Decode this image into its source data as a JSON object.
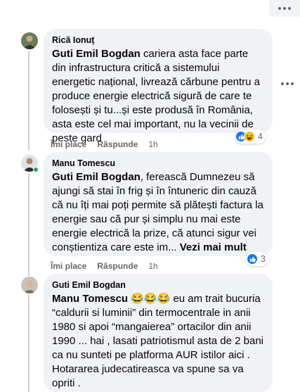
{
  "comments": [
    {
      "author": "Rică Ionuț",
      "mention": "Guti Emil Bogdan",
      "text": " cariera asta face parte din infrastructura critică a sistemului energetic național, livrează cărbune pentru a produce energie electrică sigură de care te folosești și tu...și este produsă în România, asta este cel mai important, nu la vecinii de peste gard",
      "like_label": "Îmi place",
      "reply_label": "Răspunde",
      "time": "1h",
      "reaction_count": "4",
      "reactions": [
        "like-icon",
        "haha-icon"
      ]
    },
    {
      "author": "Manu Tomescu",
      "mention": "Guti Emil Bogdan",
      "text": ", ferească Dumnezeu să ajungi să stai în frig și în întuneric din cauză că nu îți mai poți permite să plătești factura la energie sau că pur și simplu nu mai este energie electrică la prize, că atunci sigur vei conștientiza care este im...",
      "see_more": "Vezi mai mult",
      "like_label": "Îmi place",
      "reply_label": "Răspunde",
      "time": "1h",
      "reaction_count": "3",
      "reactions": [
        "like-icon"
      ]
    },
    {
      "author": "Guti Emil Bogdan",
      "mention": "Manu Tomescu",
      "emojis": "😂😂😂",
      "text": " eu am trait bucuria “caldurii si luminii” din termocentrale in anii 1980 si apoi “mangaierea” ortacilor din anii 1990 ... hai , lasati patriotismul asta de 2 bani ca nu sunteti pe platforma AUR istilor aici . Hotararea judecatireasca va spune sa va opriti ."
    }
  ],
  "colors": {
    "bubble": "#f0f2f5",
    "secondary_text": "#65676b",
    "like": "#1877f2",
    "online": "#31a24c"
  }
}
